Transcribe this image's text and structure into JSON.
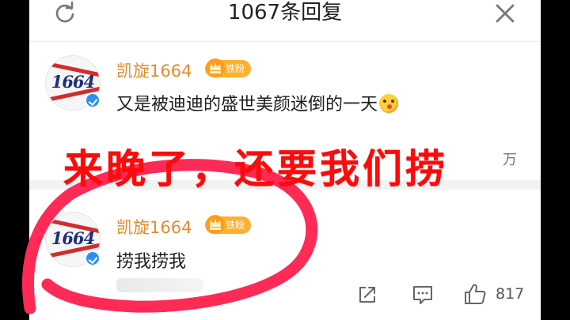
{
  "header": {
    "title": "1067条回复",
    "refresh_icon": "refresh-icon",
    "close_icon": "close-icon"
  },
  "comments": [
    {
      "username": "凯旋1664",
      "badge": "铁粉",
      "avatar_text": "1664",
      "text": "又是被迪迪的盛世美颜迷倒的一天",
      "emoji": "kissing-face-emoji"
    },
    {
      "username": "凯旋1664",
      "badge": "铁粉",
      "avatar_text": "1664",
      "text": "捞我捞我"
    }
  ],
  "partial_count": "万",
  "actions": {
    "share_icon": "share-icon",
    "comment_icon": "comment-icon",
    "like_icon": "thumbs-up-icon",
    "like_count": "817"
  },
  "overlay": {
    "caption": "来晚了，还要我们捞",
    "caption_color": "#ff0a0a",
    "circle_color": "#ff2a55"
  },
  "colors": {
    "username": "#e98a2c",
    "badge": "#ffb02e",
    "verified": "#2a8ff0"
  }
}
